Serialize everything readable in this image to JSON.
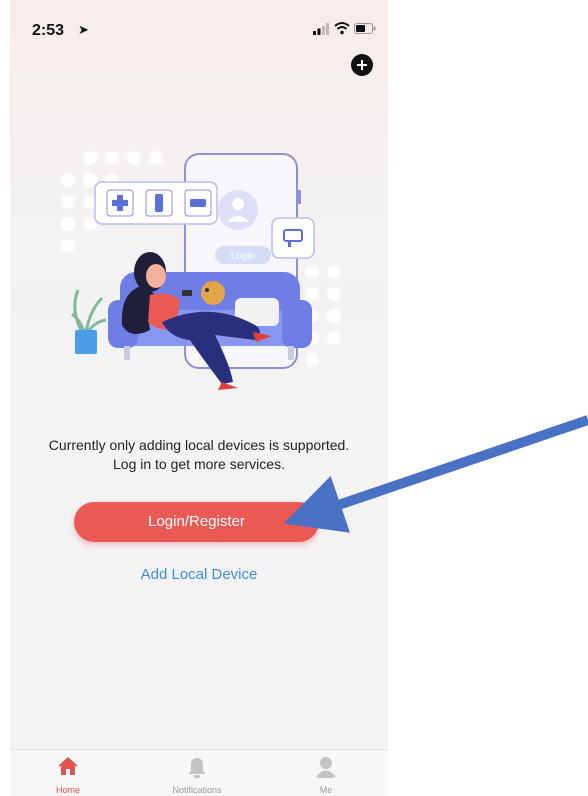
{
  "status_bar": {
    "time": "2:53"
  },
  "illustration": {
    "login_tag": "Login"
  },
  "message": {
    "line1": "Currently only adding local devices is supported.",
    "line2": "Log in to get more services."
  },
  "actions": {
    "login_register": "Login/Register",
    "add_local_device": "Add Local Device"
  },
  "tabbar": {
    "home": "Home",
    "notifications": "Notifications",
    "me": "Me"
  },
  "colors": {
    "primary_button": "#ea5a55",
    "link": "#3f8fd6",
    "active_tab": "#e05350",
    "annotation_arrow": "#4a72c4"
  },
  "icons": [
    "location-arrow-icon",
    "signal-icon",
    "wifi-icon",
    "battery-icon",
    "add-icon",
    "home-icon",
    "bell-icon",
    "person-icon"
  ]
}
